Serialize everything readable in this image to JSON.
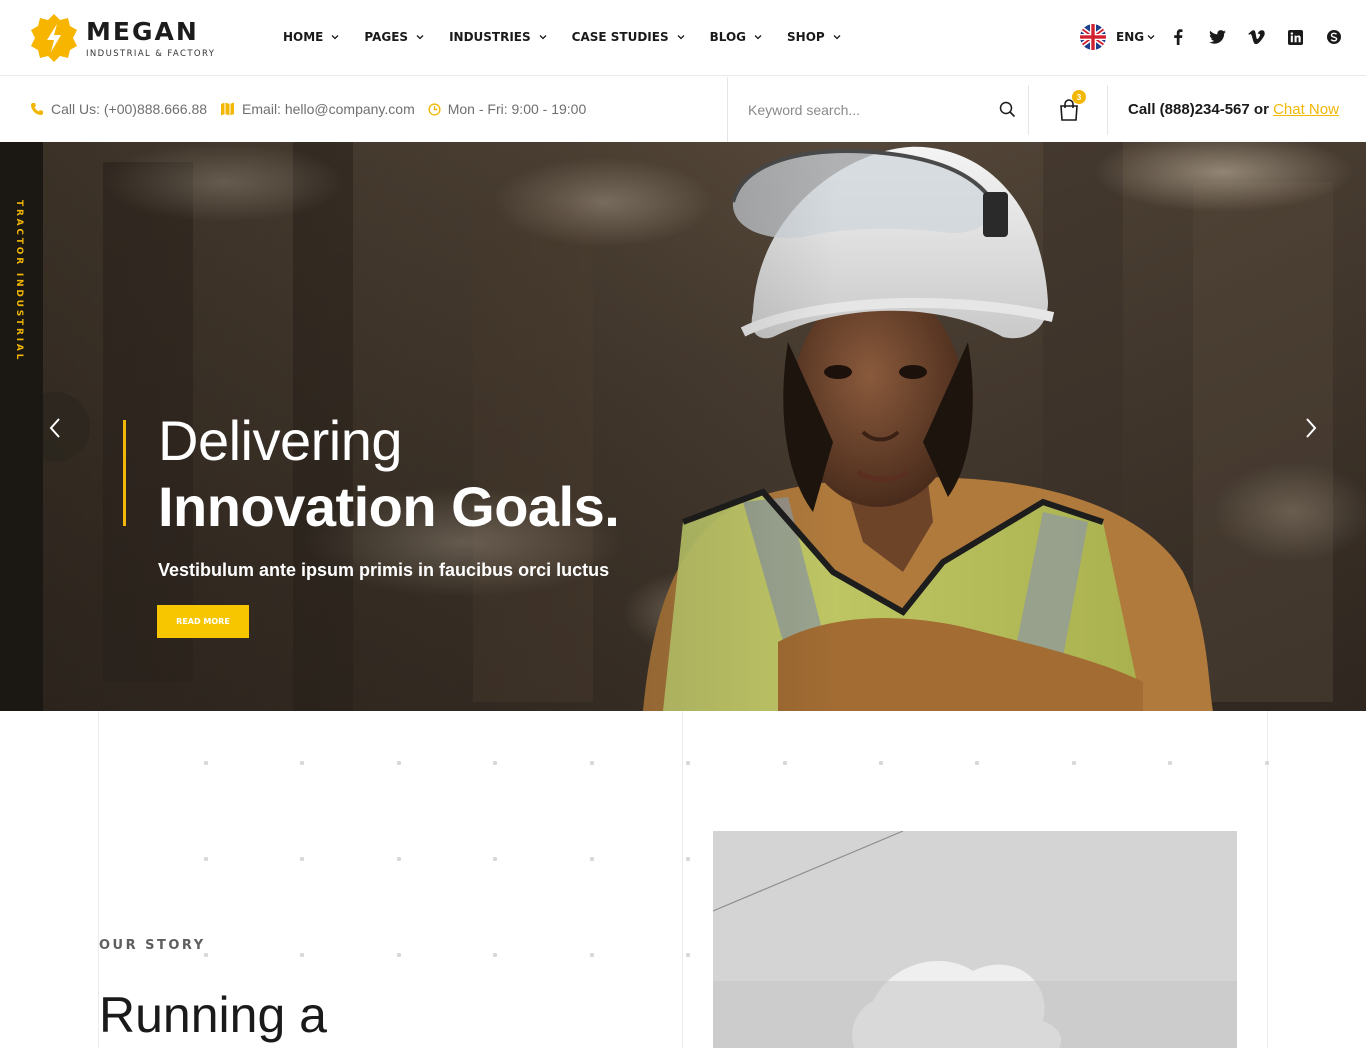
{
  "brand": {
    "name": "MEGAN",
    "tagline": "INDUSTRIAL & FACTORY",
    "accent_color": "#f2b705"
  },
  "nav": {
    "items": [
      {
        "label": "HOME"
      },
      {
        "label": "PAGES"
      },
      {
        "label": "INDUSTRIES"
      },
      {
        "label": "CASE STUDIES"
      },
      {
        "label": "BLOG"
      },
      {
        "label": "SHOP"
      }
    ]
  },
  "language": {
    "selected": "ENG",
    "flag_icon": "uk-flag-icon"
  },
  "socials": [
    "facebook-icon",
    "twitter-icon",
    "vimeo-icon",
    "linkedin-icon",
    "skype-icon"
  ],
  "info": {
    "phone": "Call Us: (+00)888.666.88",
    "email": "Email: hello@company.com",
    "hours": "Mon - Fri: 9:00 - 19:00"
  },
  "search": {
    "placeholder": "Keyword search..."
  },
  "cart": {
    "count": "3"
  },
  "contact": {
    "call_text": "Call (888)234-567 or ",
    "chat_label": "Chat Now"
  },
  "hero": {
    "side_label": "TRACTOR INDUSTRIAL",
    "title_line1": "Delivering",
    "title_line2": "Innovation Goals.",
    "subtitle": "Vestibulum ante ipsum primis in faucibus orci luctus",
    "button_label": "READ MORE"
  },
  "story": {
    "label": "OUR STORY",
    "heading": "Running a"
  }
}
